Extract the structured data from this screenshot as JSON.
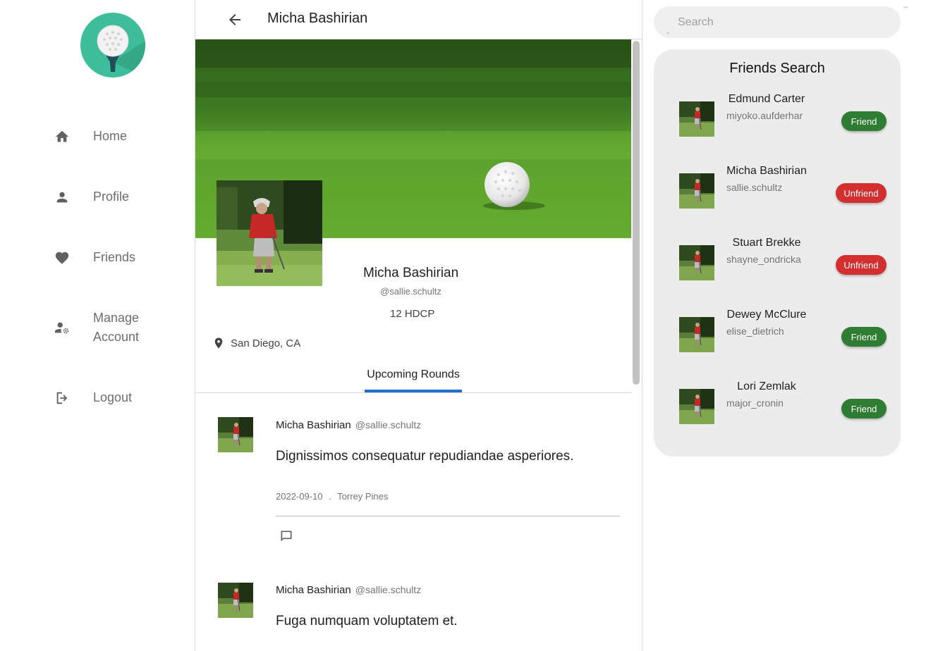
{
  "sidebar": {
    "items": [
      {
        "label": "Home",
        "icon": "home-icon"
      },
      {
        "label": "Profile",
        "icon": "person-icon"
      },
      {
        "label": "Friends",
        "icon": "heart-icon"
      },
      {
        "label": "Manage\nAccount",
        "icon": "manage-account-icon"
      },
      {
        "label": "Logout",
        "icon": "logout-icon"
      }
    ]
  },
  "header": {
    "title": "Micha Bashirian"
  },
  "profile": {
    "name": "Micha Bashirian",
    "handle": "@sallie.schultz",
    "hdcp": "12 HDCP",
    "location": "San Diego, CA"
  },
  "tabs": [
    {
      "label": "Upcoming Rounds",
      "active": true
    }
  ],
  "posts": [
    {
      "author": "Micha Bashirian",
      "handle": "@sallie.schultz",
      "body": "Dignissimos consequatur repudiandae asperiores.",
      "date": "2022-09-10",
      "sep": ".",
      "course": "Torrey Pines"
    },
    {
      "author": "Micha Bashirian",
      "handle": "@sallie.schultz",
      "body": "Fuga numquam voluptatem et."
    }
  ],
  "search": {
    "placeholder": "Search"
  },
  "friends_panel": {
    "title": "Friends Search",
    "friends": [
      {
        "name": "Edmund Carter",
        "username": "miyoko.aufderhar",
        "action": "Friend"
      },
      {
        "name": "Micha Bashirian",
        "username": "sallie.schultz",
        "action": "Unfriend"
      },
      {
        "name": "Stuart Brekke",
        "username": "shayne_ondricka",
        "action": "Unfriend"
      },
      {
        "name": "Dewey McClure",
        "username": "elise_dietrich",
        "action": "Friend"
      },
      {
        "name": "Lori Zemlak",
        "username": "major_cronin",
        "action": "Friend"
      }
    ]
  },
  "colors": {
    "accent": "#1e6fd0",
    "friend_button": "#2e7d32",
    "unfriend_button": "#d32f2f",
    "logo_bg": "#3dbd9a",
    "panel_bg": "#ececec"
  }
}
